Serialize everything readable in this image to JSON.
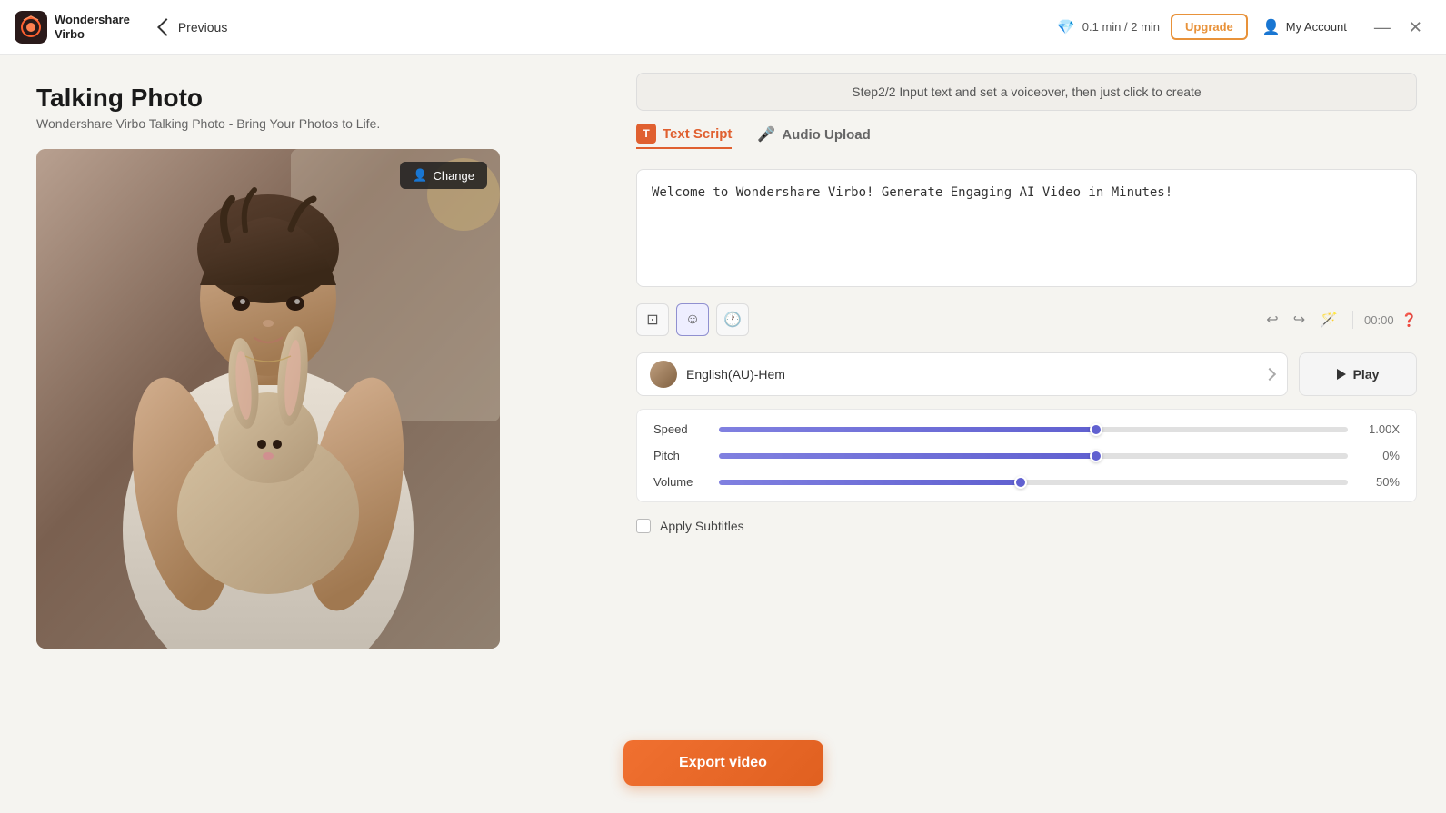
{
  "app": {
    "name": "Wondershare",
    "subname": "Virbo"
  },
  "titlebar": {
    "prev_label": "Previous",
    "usage": "0.1 min / 2 min",
    "upgrade_label": "Upgrade",
    "account_label": "My Account"
  },
  "left": {
    "title": "Talking Photo",
    "subtitle": "Wondershare Virbo Talking Photo - Bring Your Photos to Life.",
    "change_label": "Change"
  },
  "step_banner": "Step2/2 Input text and set a voiceover, then just click to create",
  "tabs": {
    "text_script": "Text Script",
    "audio_upload": "Audio Upload"
  },
  "script": {
    "content": "Welcome to Wondershare Virbo! Generate Engaging AI Video in Minutes!"
  },
  "toolbar": {
    "timestamp": "00:00"
  },
  "voice": {
    "name": "English(AU)-Hem",
    "play_label": "Play"
  },
  "sliders": {
    "speed_label": "Speed",
    "speed_value": "1.00X",
    "speed_pct": 60,
    "pitch_label": "Pitch",
    "pitch_value": "0%",
    "pitch_pct": 60,
    "volume_label": "Volume",
    "volume_value": "50%",
    "volume_pct": 48
  },
  "subtitles": {
    "label": "Apply Subtitles"
  },
  "footer": {
    "export_label": "Export video"
  }
}
